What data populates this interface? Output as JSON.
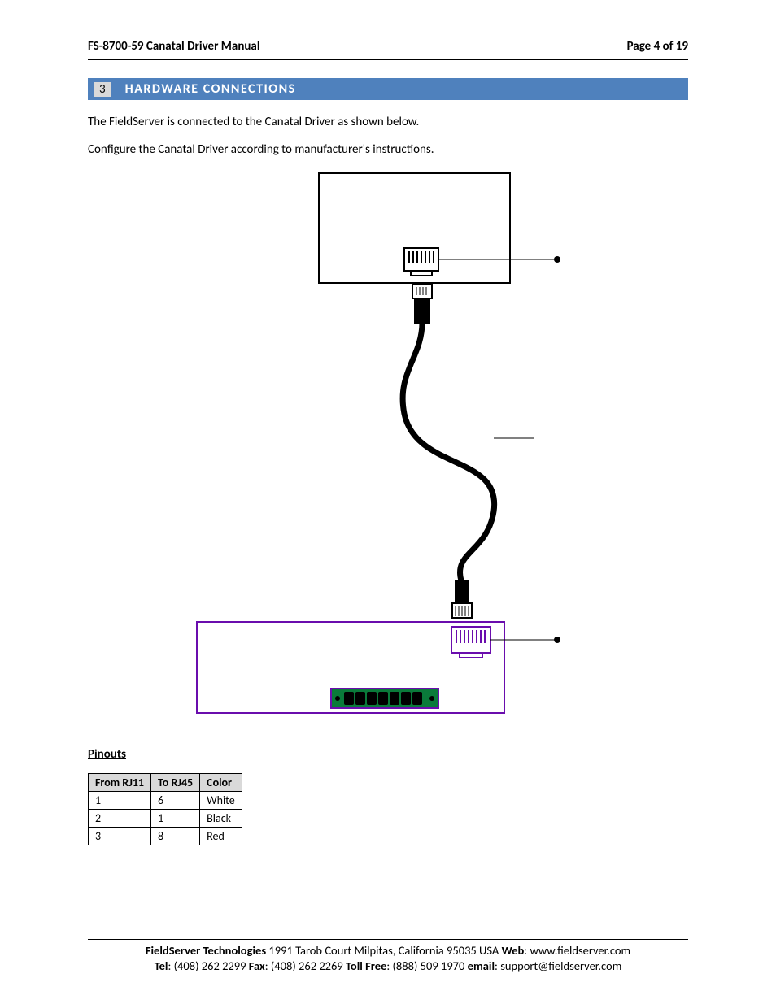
{
  "header": {
    "left": "FS-8700-59 Canatal Driver Manual",
    "right": "Page 4 of 19"
  },
  "section": {
    "num": "3",
    "title": "HARDWARE CONNECTIONS"
  },
  "para1": "The FieldServer is connected to the Canatal Driver as shown below.",
  "para2": "Configure the Canatal Driver according to manufacturer's instructions.",
  "pinouts_title": "Pinouts",
  "pinouts_headers": {
    "c1": "From RJ11",
    "c2": "To RJ45",
    "c3": "Color"
  },
  "pinouts_rows": [
    {
      "c1": "1",
      "c2": "6",
      "c3": "White"
    },
    {
      "c1": "2",
      "c2": "1",
      "c3": "Black"
    },
    {
      "c1": "3",
      "c2": "8",
      "c3": "Red"
    }
  ],
  "footer": {
    "company": "FieldServer Technologies",
    "addr": " 1991 Tarob Court Milpitas, California 95035 USA   ",
    "web_label": "Web",
    "web": ": www.fieldserver.com",
    "tel_label": "Tel",
    "tel": ": (408) 262 2299   ",
    "fax_label": "Fax",
    "fax": ": (408) 262 2269   ",
    "tollfree_label": "Toll Free",
    "tollfree": ": (888) 509 1970   ",
    "email_label": "email",
    "email": ": support@fieldserver.com"
  }
}
